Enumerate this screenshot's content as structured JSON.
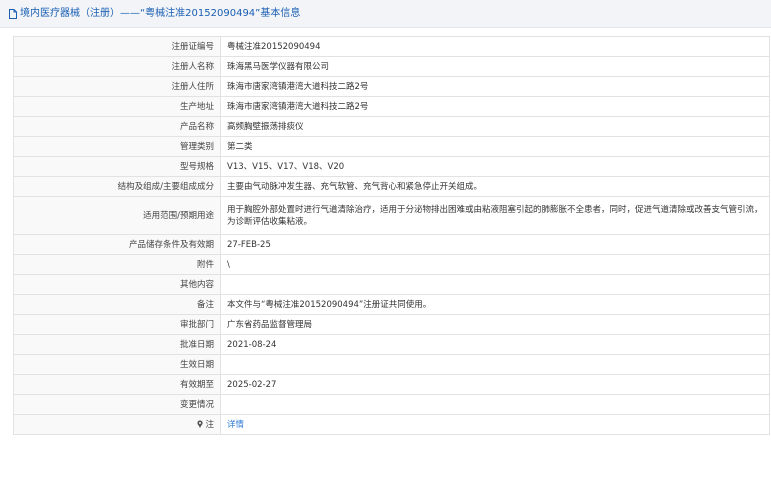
{
  "header": {
    "title": "境内医疗器械（注册）——“粤械注准20152090494”基本信息"
  },
  "rows": [
    {
      "label": "注册证编号",
      "value": "粤械注准20152090494"
    },
    {
      "label": "注册人名称",
      "value": "珠海黑马医学仪器有限公司"
    },
    {
      "label": "注册人住所",
      "value": "珠海市唐家湾镇港湾大道科技二路2号"
    },
    {
      "label": "生产地址",
      "value": "珠海市唐家湾镇港湾大道科技二路2号"
    },
    {
      "label": "产品名称",
      "value": "高频胸壁振荡排痰仪"
    },
    {
      "label": "管理类别",
      "value": "第二类"
    },
    {
      "label": "型号规格",
      "value": "V13、V15、V17、V18、V20"
    },
    {
      "label": "结构及组成/主要组成成分",
      "value": "主要由气动脉冲发生器、充气软管、充气背心和紧急停止开关组成。"
    },
    {
      "label": "适用范围/预期用途",
      "value": "用于胸腔外部处置时进行气道清除治疗，适用于分泌物排出困难或由粘液阻塞引起的肺膨胀不全患者，同时，促进气道清除或改善支气管引流，为诊断评估收集粘液。"
    },
    {
      "label": "产品储存条件及有效期",
      "value": "27-FEB-25"
    },
    {
      "label": "附件",
      "value": "\\"
    },
    {
      "label": "其他内容",
      "value": ""
    },
    {
      "label": "备注",
      "value": "本文件与“粤械注准20152090494”注册证共同使用。"
    },
    {
      "label": "审批部门",
      "value": "广东省药品监督管理局"
    },
    {
      "label": "批准日期",
      "value": "2021-08-24"
    },
    {
      "label": "生效日期",
      "value": ""
    },
    {
      "label": "有效期至",
      "value": "2025-02-27"
    },
    {
      "label": "变更情况",
      "value": ""
    }
  ],
  "note_row": {
    "label": "注",
    "icon": "pin-icon",
    "link_text": "详情"
  },
  "colors": {
    "title_blue": "#1a5fb4",
    "link_blue": "#2e7bd6",
    "label_bg": "#f9f9f9",
    "border": "#e2e2e2"
  }
}
